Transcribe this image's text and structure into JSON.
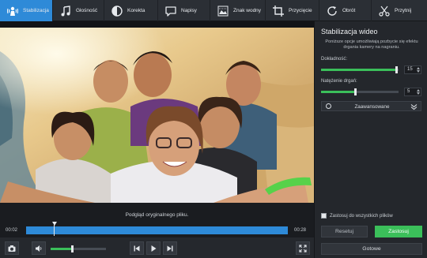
{
  "toolbar": {
    "tools": [
      {
        "label": "Stabilizacja",
        "icon": "stabilization-icon",
        "active": true
      },
      {
        "label": "Głośność",
        "icon": "music-note-icon"
      },
      {
        "label": "Korekta",
        "icon": "contrast-icon"
      },
      {
        "label": "Napisy",
        "icon": "speech-bubble-icon"
      },
      {
        "label": "Znak wodny",
        "icon": "watermark-icon"
      },
      {
        "label": "Przycięcie",
        "icon": "crop-icon"
      },
      {
        "label": "Obrót",
        "icon": "rotate-icon"
      },
      {
        "label": "Przytnij",
        "icon": "scissors-icon"
      }
    ]
  },
  "video": {
    "caption": "Podgląd oryginalnego pliku."
  },
  "timeline": {
    "current_time": "00:02",
    "total_time": "00:28",
    "progress": 0.1
  },
  "controls": {
    "volume": 0.4,
    "icons": [
      "camera-icon",
      "speaker-icon",
      "previous-frame-icon",
      "play-icon",
      "next-frame-icon",
      "fullscreen-icon"
    ]
  },
  "panel": {
    "title": "Stabilizacja wideo",
    "description": "Poniższe opcje umożliwiają pozbycie się efektu drgania kamery na nagraniu.",
    "accuracy": {
      "label": "Dokładność:",
      "value": "15",
      "level": 0.98
    },
    "shake": {
      "label": "Natężenie drgań:",
      "value": "5",
      "level": 0.45
    },
    "advanced_label": "Zaawansowane",
    "apply_all_label": "Zastosuj do wszystkich plików",
    "reset_label": "Resetuj",
    "apply_label": "Zastosuj",
    "done_label": "Gotowe"
  },
  "colors": {
    "accent_blue": "#2e8ad8",
    "accent_green": "#3bbf5a",
    "panel_bg": "#24272c",
    "toolbar_bg": "#2b2f35"
  }
}
